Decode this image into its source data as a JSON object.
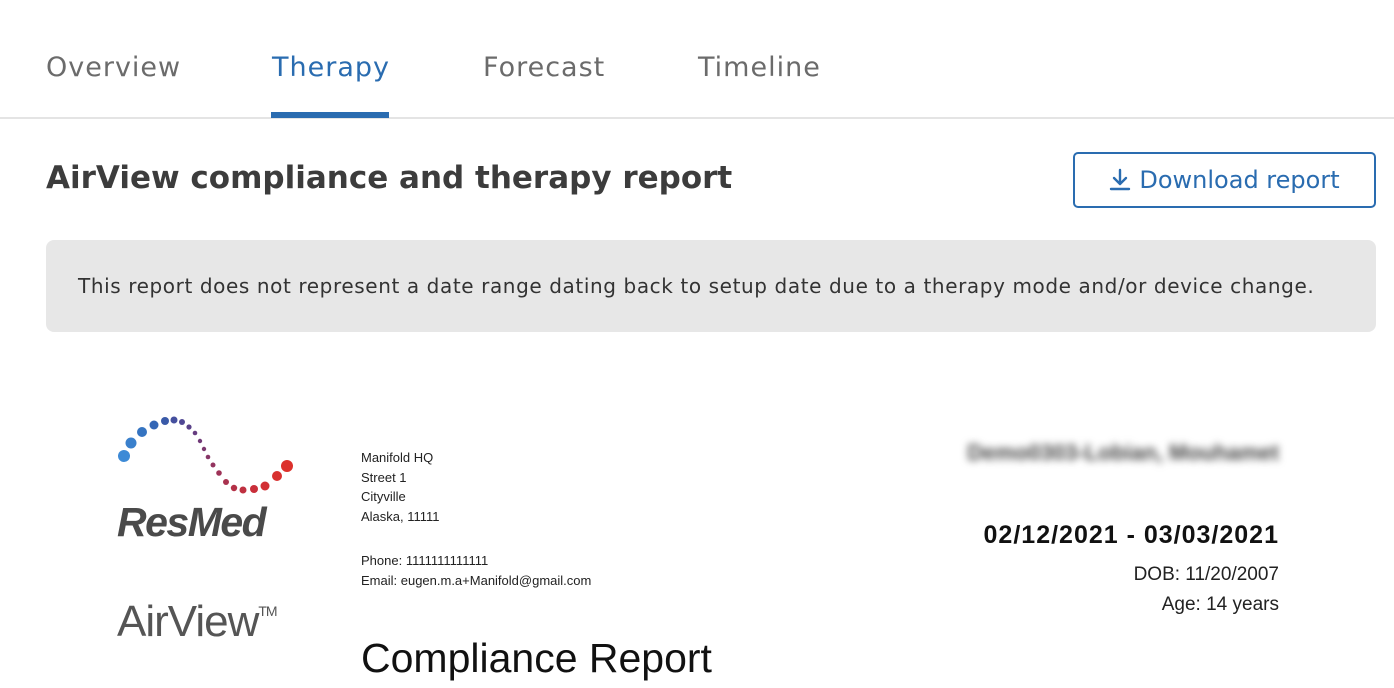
{
  "tabs": [
    {
      "label": "Overview"
    },
    {
      "label": "Therapy"
    },
    {
      "label": "Forecast"
    },
    {
      "label": "Timeline"
    }
  ],
  "active_tab": "Therapy",
  "page_title": "AirView compliance and therapy report",
  "download_button": {
    "label": "Download report",
    "icon": "download-icon"
  },
  "notice": "This report does not represent a date range dating back to setup date due to a therapy mode and/or device change.",
  "report": {
    "brand": "ResMed",
    "product": "AirView",
    "trademark": "TM",
    "address": [
      "Manifold HQ",
      "Street 1",
      "Cityville",
      "Alaska, 11111"
    ],
    "phone": "Phone: 1111111111111",
    "email": "Email: eugen.m.a+Manifold@gmail.com",
    "patient_name": "Demo0303-Lobian, Mouhamet",
    "date_range": "02/12/2021 - 03/03/2021",
    "dob": "DOB: 11/20/2007",
    "age": "Age: 14 years",
    "title": "Compliance Report"
  },
  "colors": {
    "accent": "#2a6cb0",
    "notice_bg": "#e7e7e7"
  }
}
